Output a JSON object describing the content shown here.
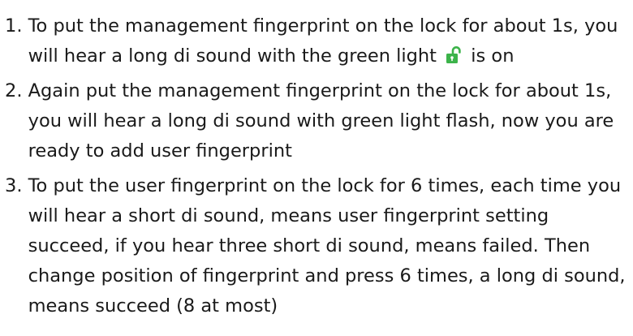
{
  "steps": [
    {
      "number": "1.",
      "text_before": "To put the management fingerprint on the lock for about 1s, you will hear a long di sound with the green light",
      "icon": "unlocked-padlock-icon",
      "text_after": "is on"
    },
    {
      "number": "2.",
      "text": "Again put the management fingerprint on the lock for about 1s, you will hear a long di sound with green light flash, now you are ready to add user fingerprint"
    },
    {
      "number": "3.",
      "text": "To put the user fingerprint on the lock for 6 times, each time you will hear a short di sound, means user fingerprint setting succeed, if you hear three short di sound, means failed. Then change position of fingerprint and press 6 times, a long di sound, means succeed (8 at most)"
    }
  ],
  "colors": {
    "text": "#1a1a1a",
    "icon_green": "#3cb34a"
  }
}
